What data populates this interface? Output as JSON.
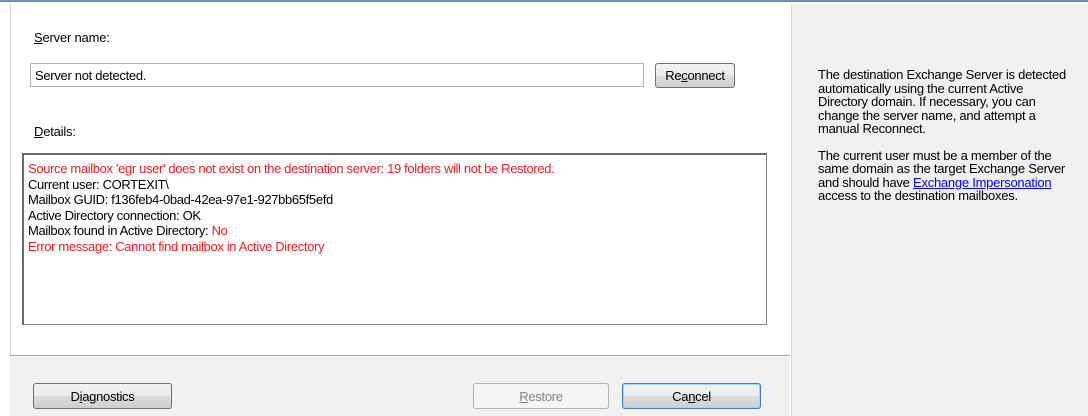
{
  "server": {
    "label_accel": "S",
    "label_rest": "erver name:",
    "value": "Server not detected.",
    "reconnect_pre": "Re",
    "reconnect_accel": "c",
    "reconnect_post": "onnect"
  },
  "details": {
    "label_accel": "D",
    "label_rest": "etails:",
    "line1": "Source mailbox 'egr user' does not exist on the destination server: 19 folders will not be Restored.",
    "line2": "Current user: CORTEXIT\\",
    "line3": "Mailbox GUID: f136feb4-0bad-42ea-97e1-927bb65f5efd",
    "line4": "Active Directory connection: OK",
    "line5_label": "Mailbox found in Active Directory: ",
    "line5_value": "No",
    "line6": "Error message: Cannot find mailbox in Active Directory"
  },
  "buttons": {
    "diagnostics_pre": "D",
    "diagnostics_accel": "i",
    "diagnostics_post": "agnostics",
    "restore_accel": "R",
    "restore_post": "estore",
    "cancel_pre": "Ca",
    "cancel_accel": "n",
    "cancel_post": "cel"
  },
  "help": {
    "para1": "The destination Exchange Server is detected automatically using the current Active Directory domain. If necessary, you can change the server name, and attempt a manual Reconnect.",
    "para2_pre": "The current user must be a member of the same domain as the target Exchange Server and should have ",
    "para2_link": "Exchange Impersonation",
    "para2_post": " access to the  destination mailboxes."
  },
  "colors": {
    "error_red": "#e8211b",
    "link_blue": "#0000ee",
    "default_button_border": "#3c7fb1"
  }
}
